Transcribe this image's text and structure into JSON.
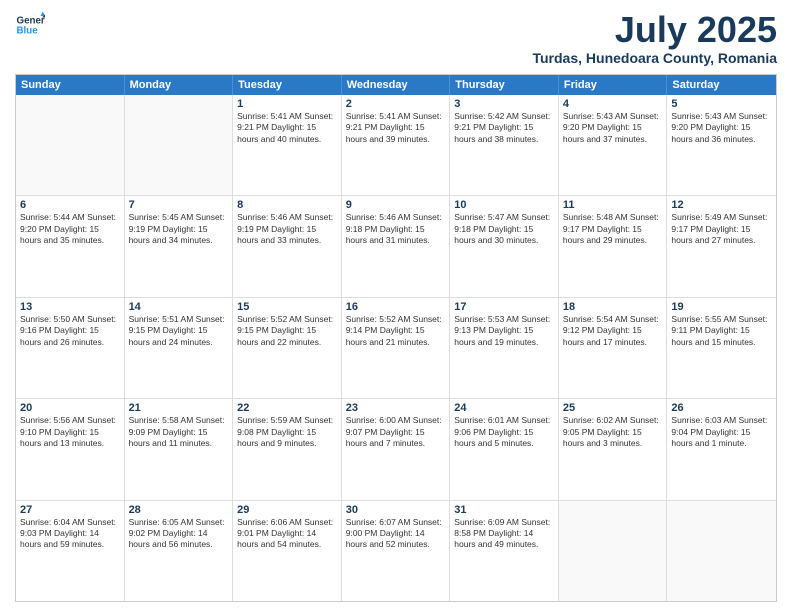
{
  "logo": {
    "line1": "General",
    "line2": "Blue"
  },
  "title": "July 2025",
  "subtitle": "Turdas, Hunedoara County, Romania",
  "header_days": [
    "Sunday",
    "Monday",
    "Tuesday",
    "Wednesday",
    "Thursday",
    "Friday",
    "Saturday"
  ],
  "weeks": [
    [
      {
        "day": "",
        "info": ""
      },
      {
        "day": "",
        "info": ""
      },
      {
        "day": "1",
        "info": "Sunrise: 5:41 AM\nSunset: 9:21 PM\nDaylight: 15 hours and 40 minutes."
      },
      {
        "day": "2",
        "info": "Sunrise: 5:41 AM\nSunset: 9:21 PM\nDaylight: 15 hours and 39 minutes."
      },
      {
        "day": "3",
        "info": "Sunrise: 5:42 AM\nSunset: 9:21 PM\nDaylight: 15 hours and 38 minutes."
      },
      {
        "day": "4",
        "info": "Sunrise: 5:43 AM\nSunset: 9:20 PM\nDaylight: 15 hours and 37 minutes."
      },
      {
        "day": "5",
        "info": "Sunrise: 5:43 AM\nSunset: 9:20 PM\nDaylight: 15 hours and 36 minutes."
      }
    ],
    [
      {
        "day": "6",
        "info": "Sunrise: 5:44 AM\nSunset: 9:20 PM\nDaylight: 15 hours and 35 minutes."
      },
      {
        "day": "7",
        "info": "Sunrise: 5:45 AM\nSunset: 9:19 PM\nDaylight: 15 hours and 34 minutes."
      },
      {
        "day": "8",
        "info": "Sunrise: 5:46 AM\nSunset: 9:19 PM\nDaylight: 15 hours and 33 minutes."
      },
      {
        "day": "9",
        "info": "Sunrise: 5:46 AM\nSunset: 9:18 PM\nDaylight: 15 hours and 31 minutes."
      },
      {
        "day": "10",
        "info": "Sunrise: 5:47 AM\nSunset: 9:18 PM\nDaylight: 15 hours and 30 minutes."
      },
      {
        "day": "11",
        "info": "Sunrise: 5:48 AM\nSunset: 9:17 PM\nDaylight: 15 hours and 29 minutes."
      },
      {
        "day": "12",
        "info": "Sunrise: 5:49 AM\nSunset: 9:17 PM\nDaylight: 15 hours and 27 minutes."
      }
    ],
    [
      {
        "day": "13",
        "info": "Sunrise: 5:50 AM\nSunset: 9:16 PM\nDaylight: 15 hours and 26 minutes."
      },
      {
        "day": "14",
        "info": "Sunrise: 5:51 AM\nSunset: 9:15 PM\nDaylight: 15 hours and 24 minutes."
      },
      {
        "day": "15",
        "info": "Sunrise: 5:52 AM\nSunset: 9:15 PM\nDaylight: 15 hours and 22 minutes."
      },
      {
        "day": "16",
        "info": "Sunrise: 5:52 AM\nSunset: 9:14 PM\nDaylight: 15 hours and 21 minutes."
      },
      {
        "day": "17",
        "info": "Sunrise: 5:53 AM\nSunset: 9:13 PM\nDaylight: 15 hours and 19 minutes."
      },
      {
        "day": "18",
        "info": "Sunrise: 5:54 AM\nSunset: 9:12 PM\nDaylight: 15 hours and 17 minutes."
      },
      {
        "day": "19",
        "info": "Sunrise: 5:55 AM\nSunset: 9:11 PM\nDaylight: 15 hours and 15 minutes."
      }
    ],
    [
      {
        "day": "20",
        "info": "Sunrise: 5:56 AM\nSunset: 9:10 PM\nDaylight: 15 hours and 13 minutes."
      },
      {
        "day": "21",
        "info": "Sunrise: 5:58 AM\nSunset: 9:09 PM\nDaylight: 15 hours and 11 minutes."
      },
      {
        "day": "22",
        "info": "Sunrise: 5:59 AM\nSunset: 9:08 PM\nDaylight: 15 hours and 9 minutes."
      },
      {
        "day": "23",
        "info": "Sunrise: 6:00 AM\nSunset: 9:07 PM\nDaylight: 15 hours and 7 minutes."
      },
      {
        "day": "24",
        "info": "Sunrise: 6:01 AM\nSunset: 9:06 PM\nDaylight: 15 hours and 5 minutes."
      },
      {
        "day": "25",
        "info": "Sunrise: 6:02 AM\nSunset: 9:05 PM\nDaylight: 15 hours and 3 minutes."
      },
      {
        "day": "26",
        "info": "Sunrise: 6:03 AM\nSunset: 9:04 PM\nDaylight: 15 hours and 1 minute."
      }
    ],
    [
      {
        "day": "27",
        "info": "Sunrise: 6:04 AM\nSunset: 9:03 PM\nDaylight: 14 hours and 59 minutes."
      },
      {
        "day": "28",
        "info": "Sunrise: 6:05 AM\nSunset: 9:02 PM\nDaylight: 14 hours and 56 minutes."
      },
      {
        "day": "29",
        "info": "Sunrise: 6:06 AM\nSunset: 9:01 PM\nDaylight: 14 hours and 54 minutes."
      },
      {
        "day": "30",
        "info": "Sunrise: 6:07 AM\nSunset: 9:00 PM\nDaylight: 14 hours and 52 minutes."
      },
      {
        "day": "31",
        "info": "Sunrise: 6:09 AM\nSunset: 8:58 PM\nDaylight: 14 hours and 49 minutes."
      },
      {
        "day": "",
        "info": ""
      },
      {
        "day": "",
        "info": ""
      }
    ]
  ]
}
